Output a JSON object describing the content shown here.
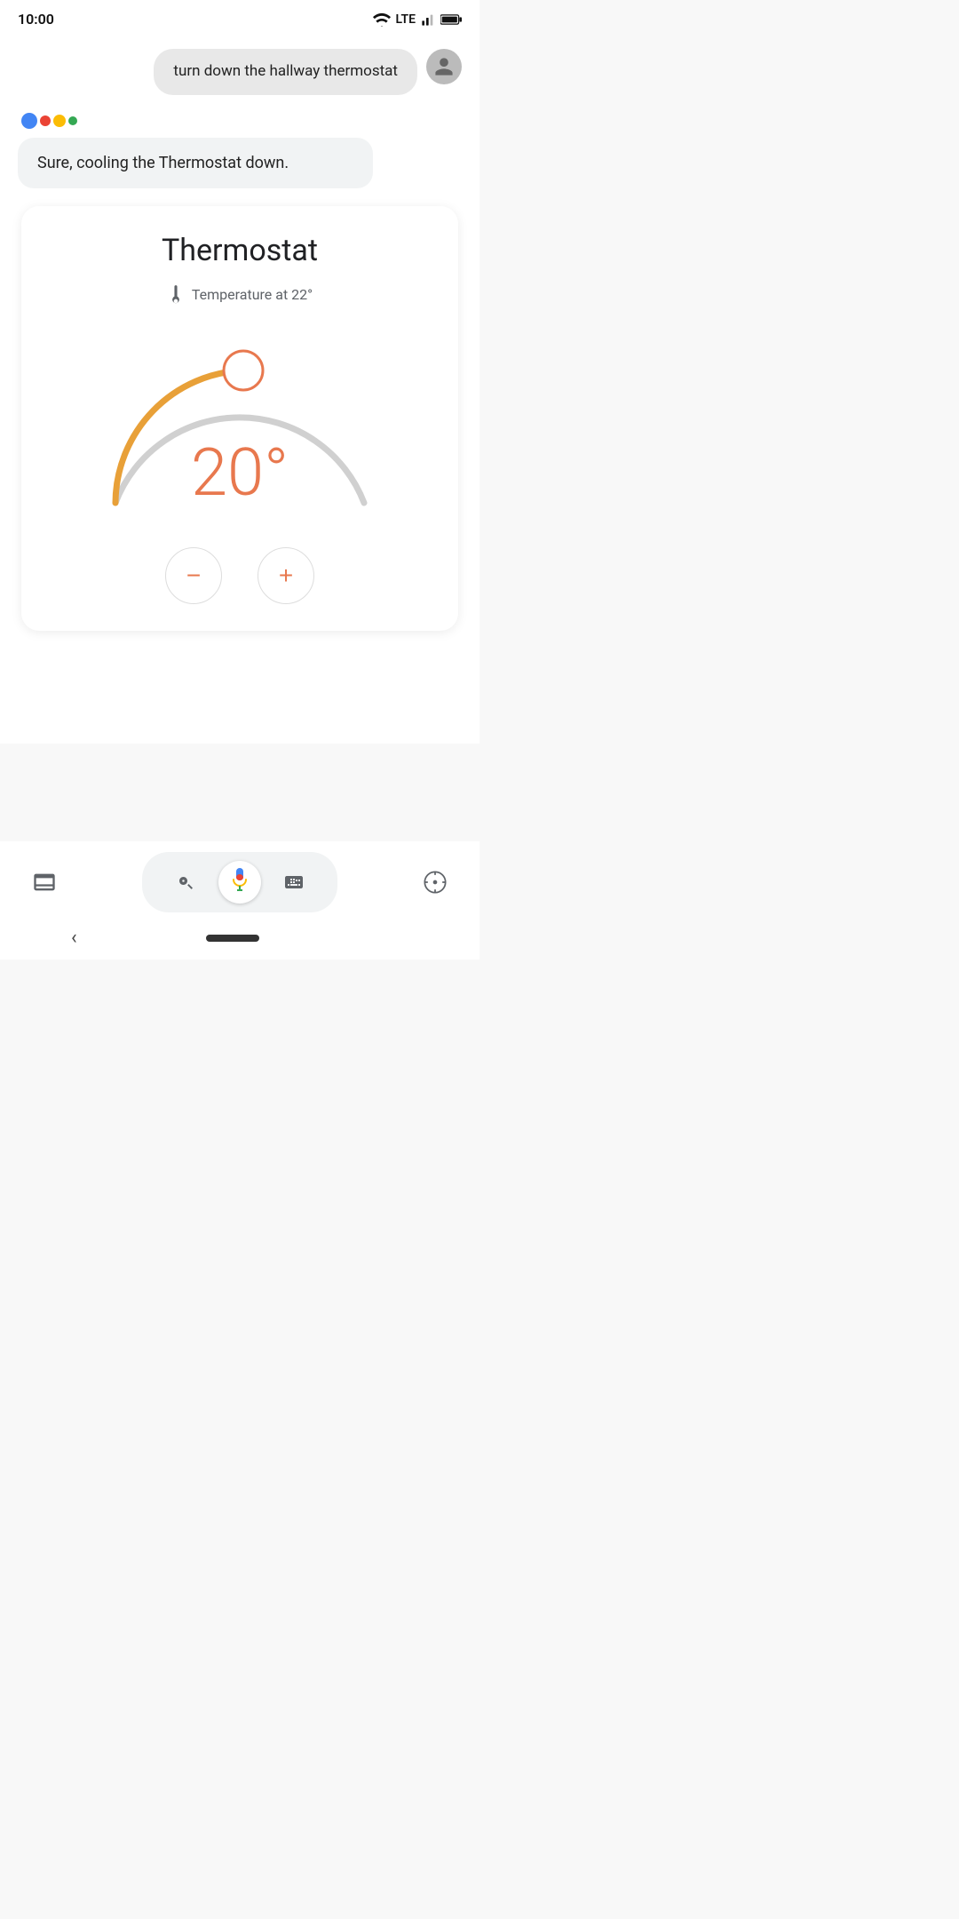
{
  "statusBar": {
    "time": "10:00",
    "wifiLabel": "wifi",
    "lteLabel": "LTE",
    "signalLabel": "signal",
    "batteryLabel": "battery"
  },
  "userMessage": {
    "text": "turn down the hallway thermostat"
  },
  "assistantResponse": {
    "text": "Sure, cooling the Thermostat down."
  },
  "thermostat": {
    "title": "Thermostat",
    "tempLabel": "Temperature at 22°",
    "currentTemp": "20°",
    "decreaseLabel": "−",
    "increaseLabel": "+"
  },
  "toolbar": {
    "assistantLabel": "Google Assistant input",
    "micLabel": "microphone",
    "keyboardLabel": "keyboard",
    "cameraLabel": "camera",
    "compassLabel": "compass",
    "inboxLabel": "inbox"
  }
}
